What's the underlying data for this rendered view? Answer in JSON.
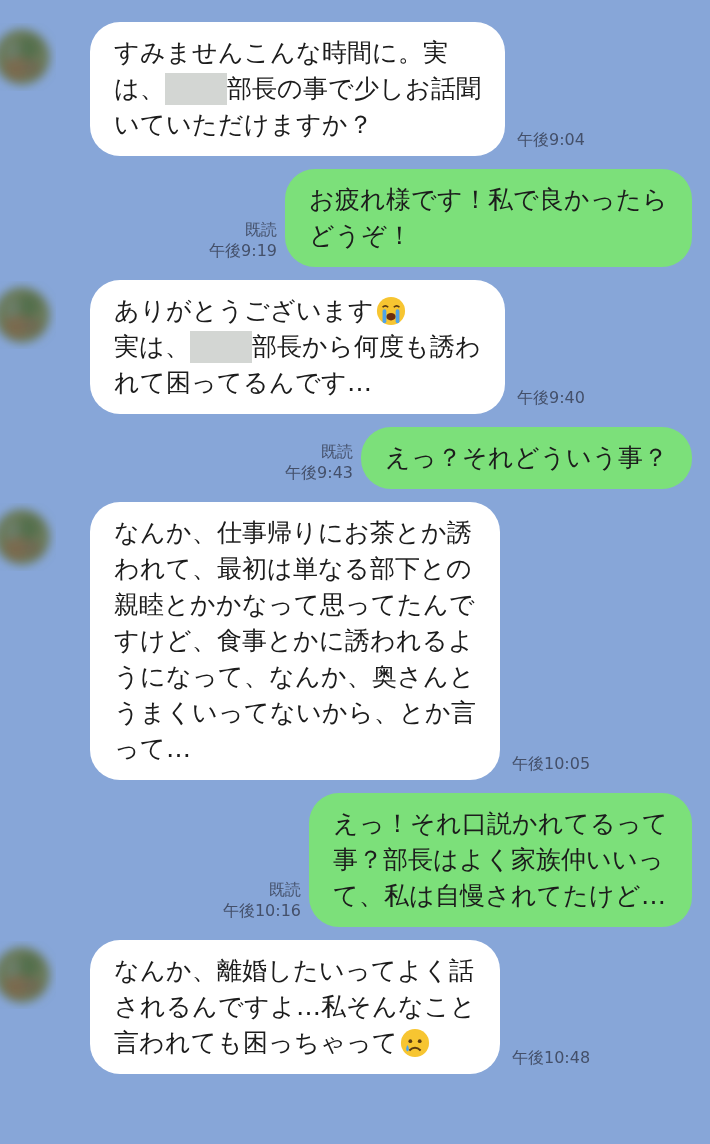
{
  "messages": [
    {
      "kind": "received",
      "time": "午後9:04",
      "lines": [
        [
          {
            "kind": "text",
            "text": "すみませんこんな時間に。実"
          }
        ],
        [
          {
            "kind": "text",
            "text": "は、"
          },
          {
            "kind": "redacted"
          },
          {
            "kind": "text",
            "text": "部長の事で少しお話聞"
          }
        ],
        [
          {
            "kind": "text",
            "text": "いていただけますか？"
          }
        ]
      ]
    },
    {
      "kind": "sent",
      "read": "既読",
      "time": "午後9:19",
      "lines": [
        [
          {
            "kind": "text",
            "text": "お疲れ様です！私で良かったら"
          }
        ],
        [
          {
            "kind": "text",
            "text": "どうぞ！"
          }
        ]
      ]
    },
    {
      "kind": "received",
      "time": "午後9:40",
      "lines": [
        [
          {
            "kind": "text",
            "text": "ありがとうございます"
          },
          {
            "kind": "sob"
          }
        ],
        [
          {
            "kind": "text",
            "text": "実は、"
          },
          {
            "kind": "redacted"
          },
          {
            "kind": "text",
            "text": "部長から何度も誘わ"
          }
        ],
        [
          {
            "kind": "text",
            "text": "れて困ってるんです…"
          }
        ]
      ]
    },
    {
      "kind": "sent",
      "read": "既読",
      "time": "午後9:43",
      "lines": [
        [
          {
            "kind": "text",
            "text": "えっ？それどういう事？"
          }
        ]
      ]
    },
    {
      "kind": "received",
      "time": "午後10:05",
      "lines": [
        [
          {
            "kind": "text",
            "text": "なんか、仕事帰りにお茶とか誘"
          }
        ],
        [
          {
            "kind": "text",
            "text": "われて、最初は単なる部下との"
          }
        ],
        [
          {
            "kind": "text",
            "text": "親睦とかかなって思ってたんで"
          }
        ],
        [
          {
            "kind": "text",
            "text": "すけど、食事とかに誘われるよ"
          }
        ],
        [
          {
            "kind": "text",
            "text": "うになって、なんか、奥さんと"
          }
        ],
        [
          {
            "kind": "text",
            "text": "うまくいってないから、とか言"
          }
        ],
        [
          {
            "kind": "text",
            "text": "って…"
          }
        ]
      ]
    },
    {
      "kind": "sent",
      "read": "既読",
      "time": "午後10:16",
      "lines": [
        [
          {
            "kind": "text",
            "text": "えっ！それ口説かれてるって"
          }
        ],
        [
          {
            "kind": "text",
            "text": "事？部長はよく家族仲いいっ"
          }
        ],
        [
          {
            "kind": "text",
            "text": "て、私は自慢されてたけど…"
          }
        ]
      ]
    },
    {
      "kind": "received",
      "time": "午後10:48",
      "lines": [
        [
          {
            "kind": "text",
            "text": "なんか、離婚したいってよく話"
          }
        ],
        [
          {
            "kind": "text",
            "text": "されるんですよ…私そんなこと"
          }
        ],
        [
          {
            "kind": "text",
            "text": "言われても困っちゃって"
          },
          {
            "kind": "tear"
          }
        ]
      ]
    }
  ]
}
